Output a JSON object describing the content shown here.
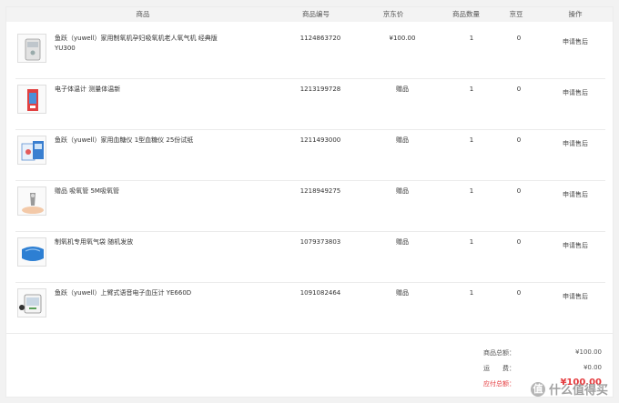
{
  "table": {
    "headers": {
      "product": "商品",
      "code": "商品编号",
      "price": "京东价",
      "qty": "商品数量",
      "bean": "京豆",
      "action": "操作"
    },
    "rows": [
      {
        "name": "鱼跃（yuwell）家用制氧机孕妇吸氧机老人氧气机 经典版 YU300",
        "code": "1124863720",
        "price": "¥100.00",
        "qty": "1",
        "bean": "0",
        "action": "申请售后",
        "thumb": "oxygen-concentrator-icon"
      },
      {
        "name": "电子体温计 测量体温新",
        "code": "1213199728",
        "price": "赠品",
        "qty": "1",
        "bean": "0",
        "action": "申请售后",
        "thumb": "thermometer-box-icon"
      },
      {
        "name": "鱼跃（yuwell）家用血糖仪 1型血糖仪 25份试纸",
        "code": "1211493000",
        "price": "赠品",
        "qty": "1",
        "bean": "0",
        "action": "申请售后",
        "thumb": "glucose-meter-icon"
      },
      {
        "name": "赠品 吸氧管 5M吸氧管",
        "code": "1218949275",
        "price": "赠品",
        "qty": "1",
        "bean": "0",
        "action": "申请售后",
        "thumb": "oxygen-tube-icon"
      },
      {
        "name": "制氧机专用氧气袋 随机发放",
        "code": "1079373803",
        "price": "赠品",
        "qty": "1",
        "bean": "0",
        "action": "申请售后",
        "thumb": "oxygen-bag-icon"
      },
      {
        "name": "鱼跃（yuwell）上臂式语音电子血压计 YE660D",
        "code": "1091082464",
        "price": "赠品",
        "qty": "1",
        "bean": "0",
        "action": "申请售后",
        "thumb": "blood-pressure-monitor-icon"
      }
    ]
  },
  "summary": {
    "goods_total_label": "商品总额：",
    "goods_total": "¥100.00",
    "shipping_label": "运　　费：",
    "shipping": "¥0.00",
    "due_label": "应付总额：",
    "due": "¥100.00"
  },
  "watermark": {
    "badge": "值",
    "text": "什么值得买"
  },
  "colors": {
    "accent_red": "#e4393c",
    "header_bg": "#f3f3f3",
    "border": "#ebebeb"
  }
}
